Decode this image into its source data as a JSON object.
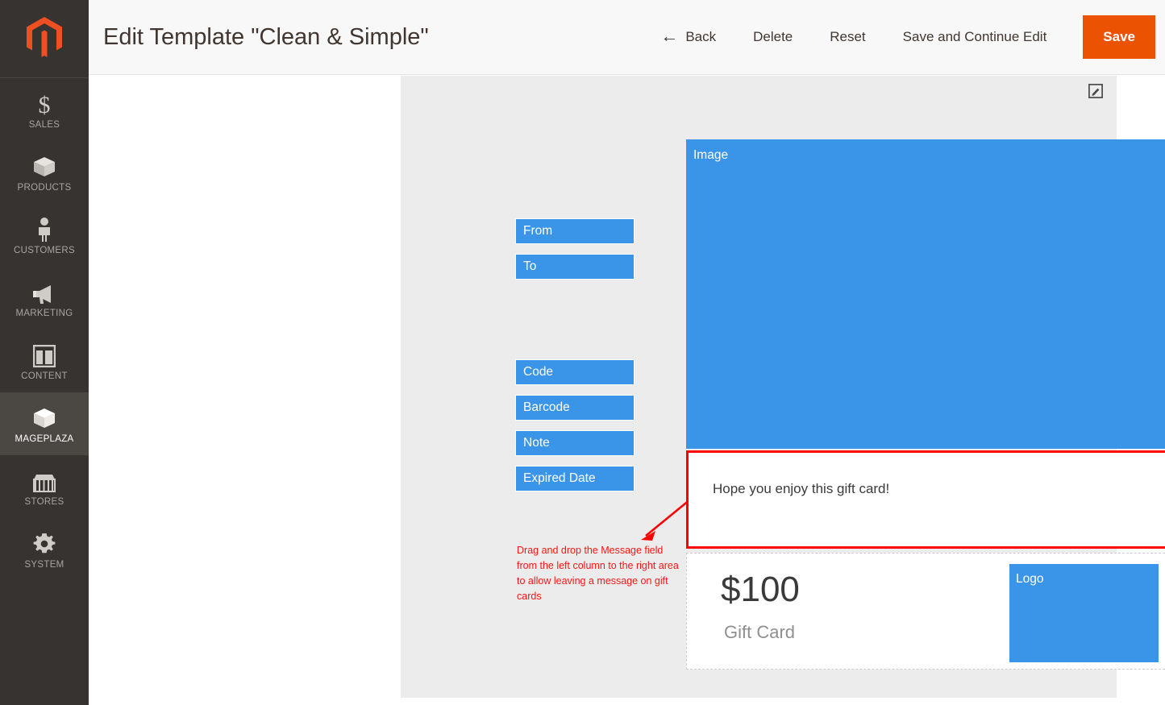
{
  "sidebar": {
    "logo": "magento-logo-icon",
    "items": [
      {
        "label": "SALES",
        "icon": "dollar-icon",
        "active": false
      },
      {
        "label": "PRODUCTS",
        "icon": "box-icon",
        "active": false
      },
      {
        "label": "CUSTOMERS",
        "icon": "person-icon",
        "active": false
      },
      {
        "label": "MARKETING",
        "icon": "megaphone-icon",
        "active": false
      },
      {
        "label": "CONTENT",
        "icon": "layout-icon",
        "active": false
      },
      {
        "label": "MAGEPLAZA",
        "icon": "box-icon",
        "active": true
      },
      {
        "label": "STORES",
        "icon": "storefront-icon",
        "active": false
      },
      {
        "label": "SYSTEM",
        "icon": "gear-icon",
        "active": false
      }
    ]
  },
  "header": {
    "title": "Edit Template \"Clean & Simple\"",
    "back_label": "Back",
    "back_arrow": "←",
    "delete_label": "Delete",
    "reset_label": "Reset",
    "save_continue_label": "Save and Continue Edit",
    "save_label": "Save",
    "save_color": "#eb5202"
  },
  "canvas": {
    "edit_icon": "edit-pencil-square-icon",
    "background": "#ececec",
    "field_chip_color": "#3a95e8",
    "fields": [
      {
        "id": "from",
        "label": "From"
      },
      {
        "id": "to",
        "label": "To"
      },
      {
        "id": "code",
        "label": "Code"
      },
      {
        "id": "barcode",
        "label": "Barcode"
      },
      {
        "id": "note",
        "label": "Note"
      },
      {
        "id": "expired",
        "label": "Expired Date"
      }
    ],
    "hint": {
      "text": "Drag and drop the Message field from the left column to the right area to allow leaving a message on gift cards",
      "color": "#ff1414",
      "arrow": "diagonal-arrow-icon"
    },
    "preview": {
      "image_label": "Image",
      "message_text": "Hope you enjoy this gift card!",
      "message_border_color": "#ff0000",
      "amount": "$100",
      "amount_caption": "Gift Card",
      "logo_label": "Logo"
    }
  }
}
